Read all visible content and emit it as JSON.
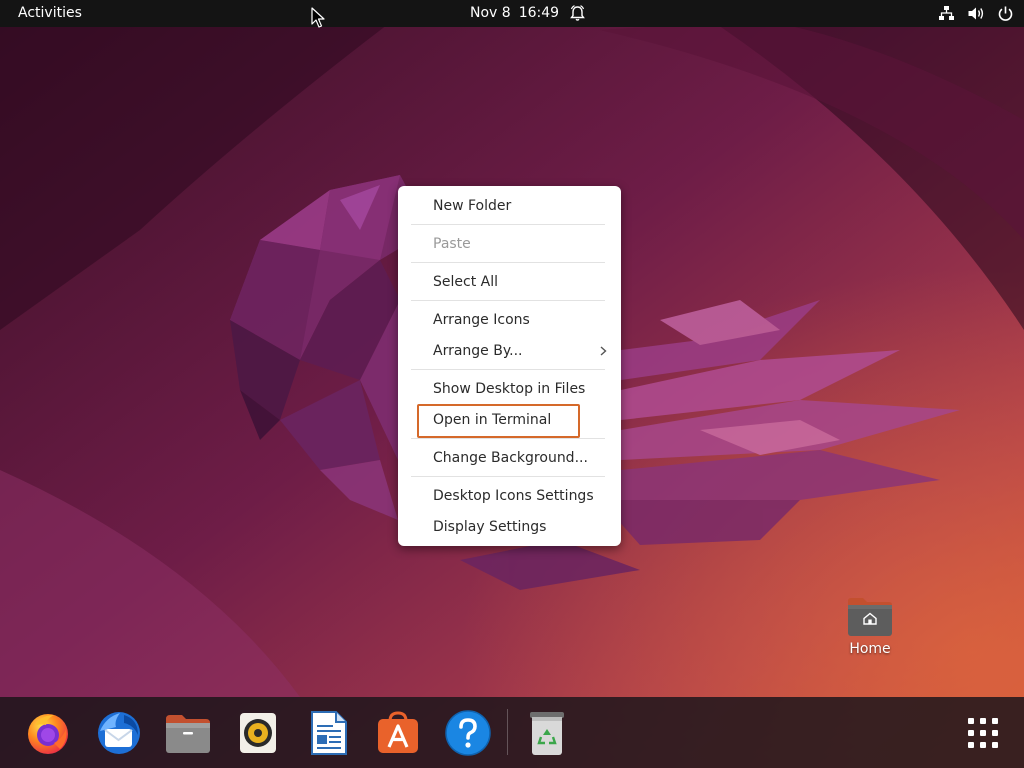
{
  "top_bar": {
    "activities_label": "Activities",
    "date": "Nov 8",
    "time": "16:49",
    "icons": [
      "alarm-bell-icon",
      "network-icon",
      "volume-icon",
      "power-icon"
    ]
  },
  "context_menu": {
    "items": [
      {
        "label": "New Folder",
        "enabled": true
      },
      {
        "label": "Paste",
        "enabled": false
      },
      {
        "label": "Select All",
        "enabled": true
      },
      {
        "label": "Arrange Icons",
        "enabled": true
      },
      {
        "label": "Arrange By...",
        "enabled": true,
        "has_submenu": true
      },
      {
        "label": "Show Desktop in Files",
        "enabled": true
      },
      {
        "label": "Open in Terminal",
        "enabled": true,
        "highlighted": true
      },
      {
        "label": "Change Background...",
        "enabled": true
      },
      {
        "label": "Desktop Icons Settings",
        "enabled": true
      },
      {
        "label": "Display Settings",
        "enabled": true
      }
    ]
  },
  "desktop": {
    "icons": [
      {
        "label": "Home",
        "icon": "home-folder-icon"
      }
    ]
  },
  "dock": {
    "apps": [
      {
        "name": "firefox",
        "icon": "firefox-icon"
      },
      {
        "name": "thunderbird",
        "icon": "thunderbird-icon"
      },
      {
        "name": "files",
        "icon": "files-icon"
      },
      {
        "name": "rhythmbox",
        "icon": "rhythmbox-icon"
      },
      {
        "name": "libreoffice-writer",
        "icon": "writer-icon"
      },
      {
        "name": "ubuntu-software",
        "icon": "software-icon"
      },
      {
        "name": "help",
        "icon": "help-icon"
      },
      {
        "name": "trash",
        "icon": "trash-icon"
      }
    ],
    "show_apps_icon": "app-grid-icon"
  },
  "colors": {
    "top_bar": "#141414",
    "highlight_box": "#d5692a",
    "menu_text": "#2b2b2b",
    "menu_disabled_text": "#9a9a9a"
  }
}
